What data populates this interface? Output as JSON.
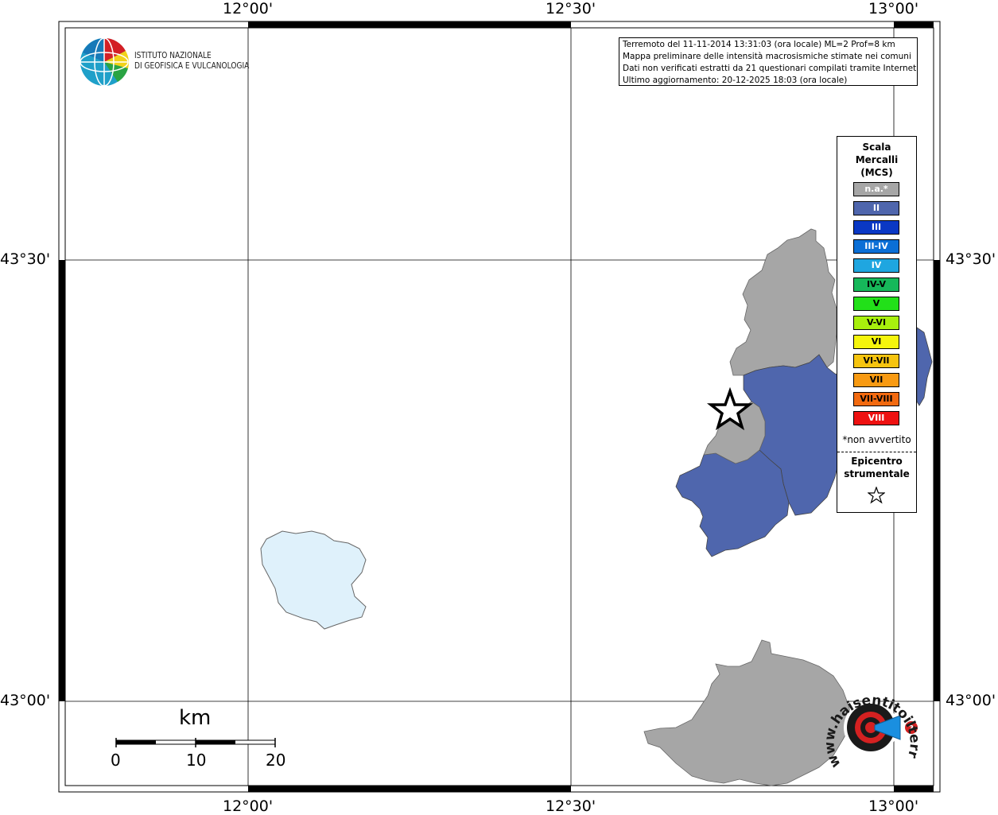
{
  "institute": {
    "name_line1": "ISTITUTO NAZIONALE",
    "name_line2": "DI GEOFISICA E VULCANOLOGIA"
  },
  "info": {
    "line1": "Terremoto del 11-11-2014 13:31:03 (ora locale) ML=2 Prof=8 km",
    "line2": "Mappa preliminare delle intensità macrosismiche stimate nei comuni",
    "line3": "Dati non verificati estratti da 21 questionari compilati tramite Internet.",
    "line4": "Ultimo aggiornamento: 20-12-2025 18:03 (ora locale)"
  },
  "axes": {
    "top": [
      "12°00'",
      "12°30'",
      "13°00'"
    ],
    "bottom": [
      "12°00'",
      "12°30'",
      "13°00'"
    ],
    "left": [
      "43°30'",
      "43°00'"
    ],
    "right": [
      "43°30'",
      "43°00'"
    ]
  },
  "scale_bar": {
    "unit": "km",
    "ticks": [
      "0",
      "10",
      "20"
    ]
  },
  "legend": {
    "title_line1": "Scala",
    "title_line2": "Mercalli",
    "title_line3": "(MCS)",
    "classes": [
      {
        "label": "n.a.*",
        "color": "#a6a6a6",
        "text_color": "#ffffff"
      },
      {
        "label": "II",
        "color": "#4f66ad",
        "text_color": "#ffffff"
      },
      {
        "label": "III",
        "color": "#0a38c4",
        "text_color": "#ffffff"
      },
      {
        "label": "III-IV",
        "color": "#0b6fd6",
        "text_color": "#ffffff"
      },
      {
        "label": "IV",
        "color": "#1fa6e0",
        "text_color": "#ffffff"
      },
      {
        "label": "IV-V",
        "color": "#16b85a",
        "text_color": "#000000"
      },
      {
        "label": "V",
        "color": "#22e019",
        "text_color": "#000000"
      },
      {
        "label": "V-VI",
        "color": "#a8f00d",
        "text_color": "#000000"
      },
      {
        "label": "VI",
        "color": "#f5f50c",
        "text_color": "#000000"
      },
      {
        "label": "VI-VII",
        "color": "#f6c40f",
        "text_color": "#000000"
      },
      {
        "label": "VII",
        "color": "#f89a12",
        "text_color": "#000000"
      },
      {
        "label": "VII-VIII",
        "color": "#f26a10",
        "text_color": "#000000"
      },
      {
        "label": "VIII",
        "color": "#ee1111",
        "text_color": "#ffffff"
      }
    ],
    "note": "*non avvertito",
    "epicenter_line1": "Epicentro",
    "epicenter_line2": "strumentale"
  },
  "watermark": {
    "text": "www.haisentitoilterremoto.it",
    "color_red": "#d42121",
    "color_blue": "#1a8fe0"
  },
  "colors": {
    "lake": "#dff1fb",
    "na": "#a6a6a6",
    "intensity_II": "#4f66ad"
  }
}
